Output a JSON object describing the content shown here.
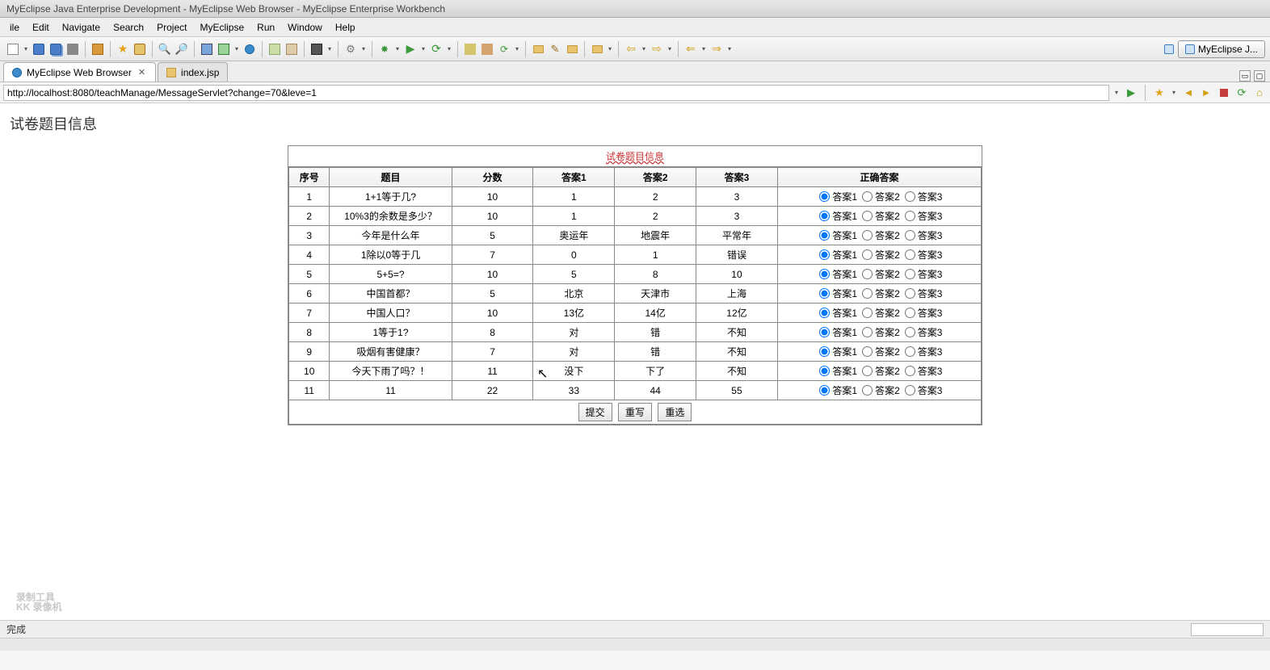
{
  "window_title": "MyEclipse Java Enterprise Development - MyEclipse Web Browser - MyEclipse Enterprise Workbench",
  "menu": [
    "ile",
    "Edit",
    "Navigate",
    "Search",
    "Project",
    "MyEclipse",
    "Run",
    "Window",
    "Help"
  ],
  "perspective_label": "MyEclipse J...",
  "tabs": [
    {
      "label": "MyEclipse Web Browser",
      "active": true,
      "closable": true
    },
    {
      "label": "index.jsp",
      "active": false,
      "closable": false
    }
  ],
  "url": "http://localhost:8080/teachManage/MessageServlet?change=70&leve=1",
  "page_heading": "试卷题目信息",
  "table_title": "试卷题目信息",
  "columns": [
    "序号",
    "题目",
    "分数",
    "答案1",
    "答案2",
    "答案3",
    "正确答案"
  ],
  "answer_labels": [
    "答案1",
    "答案2",
    "答案3"
  ],
  "rows": [
    {
      "seq": "1",
      "q": "1+1等于几?",
      "score": "10",
      "a1": "1",
      "a2": "2",
      "a3": "3",
      "correct": 0
    },
    {
      "seq": "2",
      "q": "10%3的余数是多少？",
      "score": "10",
      "a1": "1",
      "a2": "2",
      "a3": "3",
      "correct": 0
    },
    {
      "seq": "3",
      "q": "今年是什么年",
      "score": "5",
      "a1": "奥运年",
      "a2": "地震年",
      "a3": "平常年",
      "correct": 0
    },
    {
      "seq": "4",
      "q": "1除以0等于几",
      "score": "7",
      "a1": "0",
      "a2": "1",
      "a3": "错误",
      "correct": 0
    },
    {
      "seq": "5",
      "q": "5+5=?",
      "score": "10",
      "a1": "5",
      "a2": "8",
      "a3": "10",
      "correct": 0
    },
    {
      "seq": "6",
      "q": "中国首都？",
      "score": "5",
      "a1": "北京",
      "a2": "天津市",
      "a3": "上海",
      "correct": 0
    },
    {
      "seq": "7",
      "q": "中国人口？",
      "score": "10",
      "a1": "13亿",
      "a2": "14亿",
      "a3": "12亿",
      "correct": 0
    },
    {
      "seq": "8",
      "q": "1等于1?",
      "score": "8",
      "a1": "对",
      "a2": "错",
      "a3": "不知",
      "correct": 0
    },
    {
      "seq": "9",
      "q": "吸烟有害健康？",
      "score": "7",
      "a1": "对",
      "a2": "错",
      "a3": "不知",
      "correct": 0
    },
    {
      "seq": "10",
      "q": "今天下雨了吗？！",
      "score": "11",
      "a1": "没下",
      "a2": "下了",
      "a3": "不知",
      "correct": 0
    },
    {
      "seq": "11",
      "q": "11",
      "score": "22",
      "a1": "33",
      "a2": "44",
      "a3": "55",
      "correct": 0
    }
  ],
  "buttons": {
    "submit": "提交",
    "rewrite": "重写",
    "reselect": "重选"
  },
  "status_text": "完成",
  "watermark": {
    "line1": "录制工具",
    "line2": "KK 录像机"
  }
}
